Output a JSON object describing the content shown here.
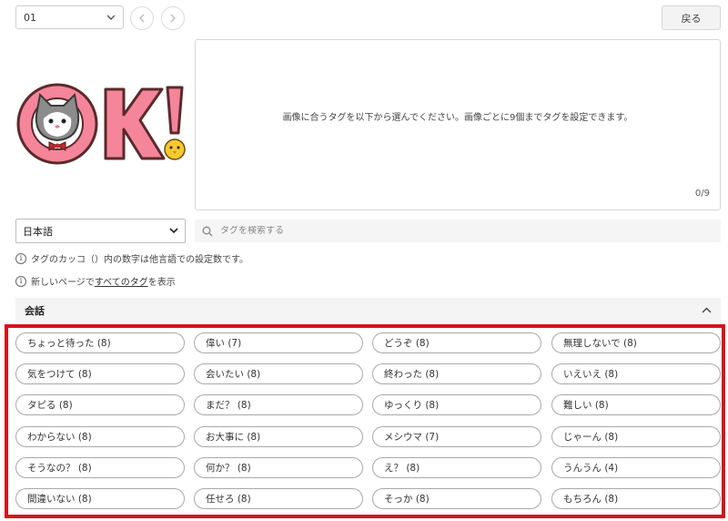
{
  "top": {
    "page_select": "01",
    "back_label": "戻る"
  },
  "sticker": {
    "alt": "OK! sticker with gray cat and chick",
    "colors": {
      "pink": "#f4859a",
      "outline": "#5a2a2a",
      "cat": "#8c8c8c",
      "bow": "#c0272d",
      "chick": "#f6c931"
    }
  },
  "tag_panel": {
    "message": "画像に合うタグを以下から選んでください。画像ごとに9個までタグを設定できます。",
    "count": "0/9"
  },
  "language": {
    "selected": "日本語"
  },
  "search": {
    "placeholder": "タグを検索する"
  },
  "info": {
    "line1": "タグのカッコ（）内の数字は他言語での設定数です。",
    "line2_prefix": "新しいページで",
    "line2_link": "すべてのタグ",
    "line2_suffix": "を表示"
  },
  "section": {
    "title": "会話"
  },
  "tags": [
    [
      "ちょっと待った (8)",
      "偉い (7)",
      "どうぞ (8)",
      "無理しないで (8)"
    ],
    [
      "気をつけて (8)",
      "会いたい (8)",
      "終わった (8)",
      "いえいえ (8)"
    ],
    [
      "タピる (8)",
      "まだ？ (8)",
      "ゆっくり (8)",
      "難しい (8)"
    ],
    [
      "わからない (8)",
      "お大事に (8)",
      "メシウマ (7)",
      "じゃーん (8)"
    ],
    [
      "そうなの？ (8)",
      "何か？ (8)",
      "え？ (8)",
      "うんうん (4)"
    ],
    [
      "間違いない (8)",
      "任せろ (8)",
      "そっか (8)",
      "もちろん (8)"
    ]
  ],
  "highlight_color": "#d4141c"
}
